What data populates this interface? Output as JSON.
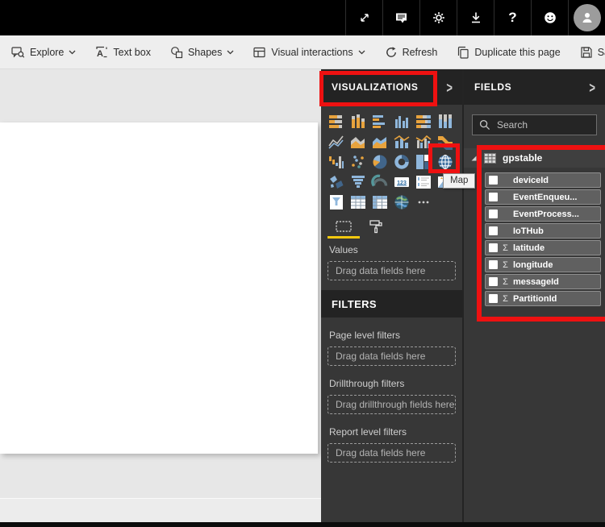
{
  "colors": {
    "accent_red": "#ee1111",
    "accent_yellow": "#f2c80f",
    "panel_bg": "#373737",
    "panel_header_bg": "#232323",
    "topbar_bg": "#000000",
    "toolbar_bg": "#eeeeee"
  },
  "topbar": {
    "icons": [
      {
        "name": "expand-icon"
      },
      {
        "name": "comment-feedback-icon"
      },
      {
        "name": "settings-gear-icon"
      },
      {
        "name": "download-icon"
      },
      {
        "name": "help-icon"
      },
      {
        "name": "smiley-feedback-icon"
      },
      {
        "name": "avatar"
      }
    ]
  },
  "toolbar": {
    "items": [
      {
        "name": "explore",
        "label": "Explore",
        "icon": "explore",
        "chevron": true
      },
      {
        "name": "text-box",
        "label": "Text box",
        "icon": "textbox",
        "chevron": false
      },
      {
        "name": "shapes",
        "label": "Shapes",
        "icon": "shapes",
        "chevron": true
      },
      {
        "name": "visual-interactions",
        "label": "Visual interactions",
        "icon": "visual-interactions",
        "chevron": true
      },
      {
        "name": "refresh",
        "label": "Refresh",
        "icon": "refresh",
        "chevron": false
      },
      {
        "name": "duplicate-this-page",
        "label": "Duplicate this page",
        "icon": "duplicate",
        "chevron": false
      },
      {
        "name": "save",
        "label": "Save",
        "icon": "save",
        "chevron": false
      }
    ],
    "more_label": "···"
  },
  "visualizations": {
    "title": "VISUALIZATIONS",
    "collapse_arrow": ">",
    "icons": [
      "stacked-bar-chart",
      "stacked-column-chart",
      "clustered-bar-chart",
      "clustered-column-chart",
      "hundred-stacked-bar-chart",
      "hundred-stacked-column-chart",
      "line-chart",
      "area-chart",
      "stacked-area-chart",
      "line-and-stacked-column-chart",
      "line-and-clustered-column-chart",
      "ribbon-chart",
      "waterfall-chart",
      "scatter-chart",
      "pie-chart",
      "donut-chart",
      "treemap",
      "map",
      "filled-map",
      "funnel",
      "gauge",
      "card",
      "multi-row-card",
      "kpi",
      "slicer",
      "table",
      "matrix",
      "arcgis-map",
      "more-options"
    ],
    "highlighted_icon": "map",
    "tooltip": "Map",
    "values_label": "Values",
    "values_placeholder": "Drag data fields here"
  },
  "filters": {
    "title": "FILTERS",
    "sections": [
      {
        "label": "Page level filters",
        "placeholder": "Drag data fields here"
      },
      {
        "label": "Drillthrough filters",
        "placeholder": "Drag drillthrough fields here"
      },
      {
        "label": "Report level filters",
        "placeholder": "Drag data fields here"
      }
    ]
  },
  "fields": {
    "title": "FIELDS",
    "collapse_arrow": ">",
    "search_placeholder": "Search",
    "table": {
      "name": "gpstable",
      "fields": [
        {
          "name": "deviceId",
          "numeric": false
        },
        {
          "name": "EventEnqueu...",
          "numeric": false
        },
        {
          "name": "EventProcess...",
          "numeric": false
        },
        {
          "name": "IoTHub",
          "numeric": false
        },
        {
          "name": "latitude",
          "numeric": true
        },
        {
          "name": "longitude",
          "numeric": true
        },
        {
          "name": "messageId",
          "numeric": true
        },
        {
          "name": "PartitionId",
          "numeric": true
        }
      ]
    }
  }
}
